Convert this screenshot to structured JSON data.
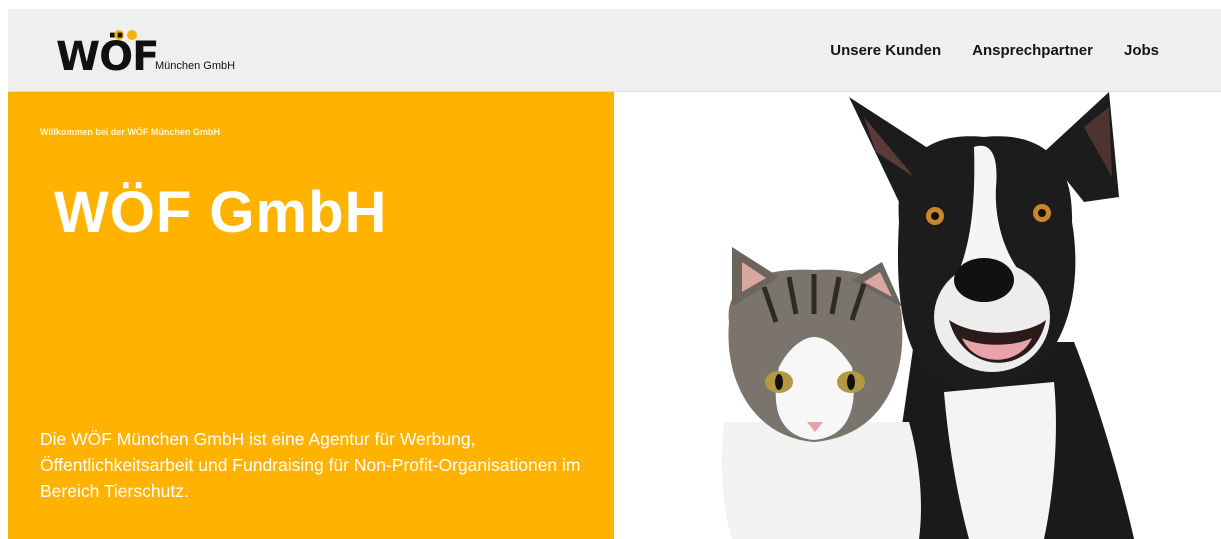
{
  "logo": {
    "wordmark": "WÖF",
    "subtitle": "München GmbH",
    "dot_color": "#f4b400"
  },
  "nav": {
    "items": [
      {
        "label": "Unsere Kunden"
      },
      {
        "label": "Ansprechpartner"
      },
      {
        "label": "Jobs"
      }
    ]
  },
  "hero": {
    "welcome": "Willkommen bei der WÖF München GmbH",
    "title": "WÖF GmbH",
    "description": "Die WÖF München GmbH ist eine Agentur für Werbung, Öffentlichkeitsarbeit und Fundraising für Non-Profit-Organisationen im Bereich Tierschutz.",
    "background_color": "#ffb300"
  },
  "image": {
    "subject": "cat-and-dog-photo"
  }
}
